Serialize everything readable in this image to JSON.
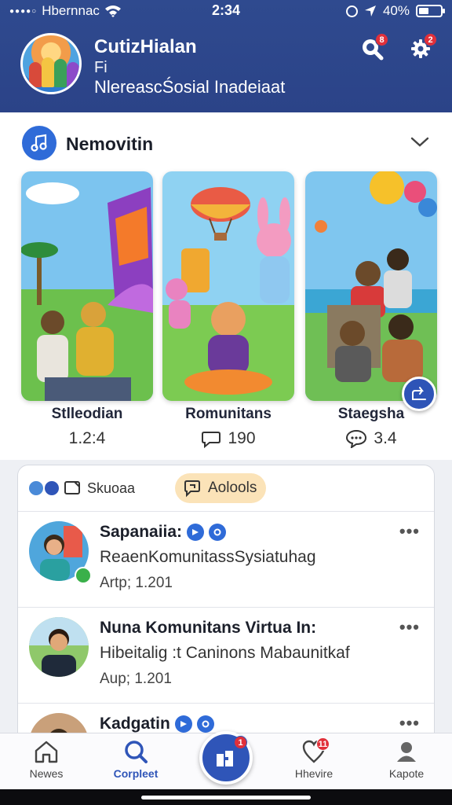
{
  "status_bar": {
    "carrier": "Hbernnac",
    "time": "2:34",
    "battery": "40%"
  },
  "header": {
    "title": "CutizHialan",
    "subtitle": "Fi",
    "description": "NlereascŚosial Inadeiaat",
    "search_badge": "8",
    "settings_badge": "2"
  },
  "stories": {
    "title": "Nemovitin",
    "cards": [
      {
        "label": "Stlleodian",
        "count": "1.2:4",
        "icon": "none"
      },
      {
        "label": "Romunitans",
        "count": "190",
        "icon": "chat-bubble-icon"
      },
      {
        "label": "Staegsha",
        "count": "3.4",
        "icon": "comment-dots-icon"
      }
    ]
  },
  "feed": {
    "tab_a": "Skuoaa",
    "tab_b": "Aolools",
    "posts": [
      {
        "name": "Sapanaiia:",
        "body": "ReaenKomunitassSysiatuhag",
        "meta": "Artp; 1.201"
      },
      {
        "name": "Nuna Komunitans Virtua In:",
        "body": "Hibeitalig :t Caninons Mabaunitkaf",
        "meta": "Aup; 1.201"
      },
      {
        "name": "Kadgatin",
        "body": "",
        "meta": ""
      }
    ]
  },
  "bottom_nav": {
    "items": [
      {
        "label": "Newes"
      },
      {
        "label": "Corpleet"
      },
      {
        "label": ""
      },
      {
        "label": "Hhevire",
        "badge": "11"
      },
      {
        "label": "Kapote"
      }
    ],
    "center_badge": "1"
  },
  "colors": {
    "header": "#2f4a8f",
    "accent": "#2f55b8",
    "badge": "#e1303a",
    "active_nav": "#2f55b8"
  }
}
